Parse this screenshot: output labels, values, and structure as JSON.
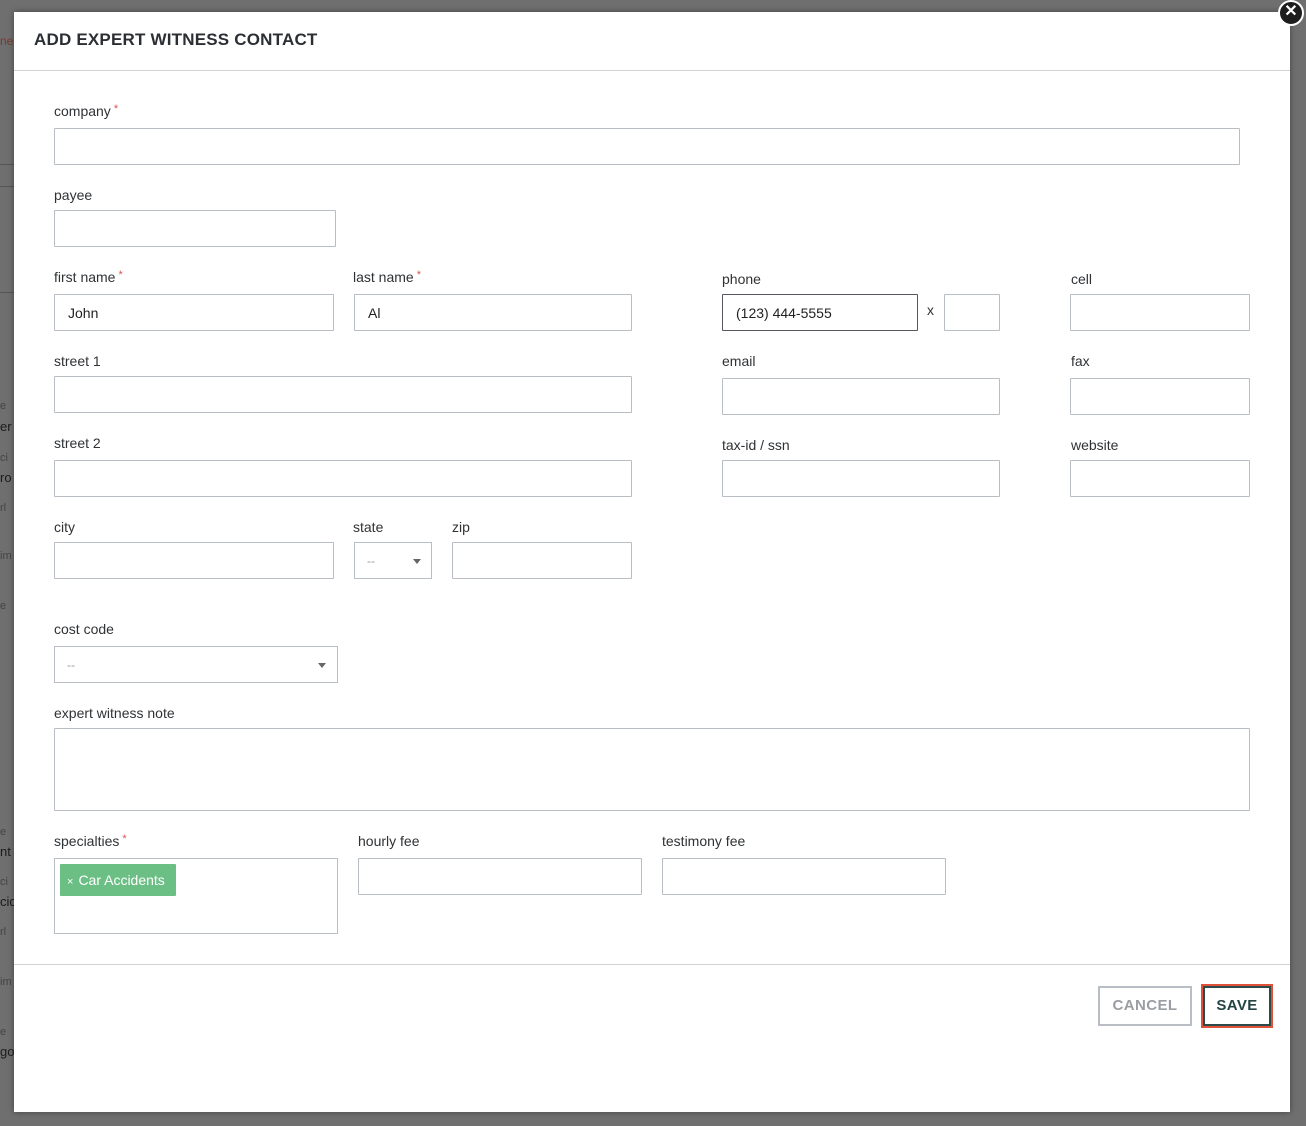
{
  "modal": {
    "title": "ADD EXPERT WITNESS CONTACT",
    "close_glyph": "✕"
  },
  "form": {
    "company": {
      "label": "company",
      "value": ""
    },
    "payee": {
      "label": "payee",
      "value": ""
    },
    "first_name": {
      "label": "first name",
      "value": "John"
    },
    "last_name": {
      "label": "last name",
      "value": "Al"
    },
    "phone": {
      "label": "phone",
      "value": "(123) 444-5555",
      "ext_separator": "x",
      "ext_value": ""
    },
    "cell": {
      "label": "cell",
      "value": ""
    },
    "street1": {
      "label": "street 1",
      "value": ""
    },
    "email": {
      "label": "email",
      "value": ""
    },
    "fax": {
      "label": "fax",
      "value": ""
    },
    "street2": {
      "label": "street 2",
      "value": ""
    },
    "tax_id": {
      "label": "tax-id / ssn",
      "value": ""
    },
    "website": {
      "label": "website",
      "value": ""
    },
    "city": {
      "label": "city",
      "value": ""
    },
    "state": {
      "label": "state",
      "selected": "--"
    },
    "zip": {
      "label": "zip",
      "value": ""
    },
    "cost_code": {
      "label": "cost code",
      "selected": "--"
    },
    "note": {
      "label": "expert witness note",
      "value": ""
    },
    "specialties": {
      "label": "specialties",
      "tags": [
        "Car Accidents"
      ],
      "remove_glyph": "×"
    },
    "hourly_fee": {
      "label": "hourly fee",
      "value": ""
    },
    "testimony_fee": {
      "label": "testimony fee",
      "value": ""
    },
    "required_mark": "*"
  },
  "footer": {
    "cancel_label": "CANCEL",
    "save_label": "SAVE"
  },
  "colors": {
    "tag_bg": "#6bbf84",
    "required": "#d9534f",
    "save_text": "#244444",
    "save_highlight": "#e0513a"
  },
  "background": {
    "fragments": [
      "ne",
      "e",
      "er",
      "ci",
      "ro",
      "rl",
      "im",
      "e",
      "e",
      "nt",
      "ci",
      "cid",
      "rl",
      "im",
      "e",
      "go"
    ]
  }
}
